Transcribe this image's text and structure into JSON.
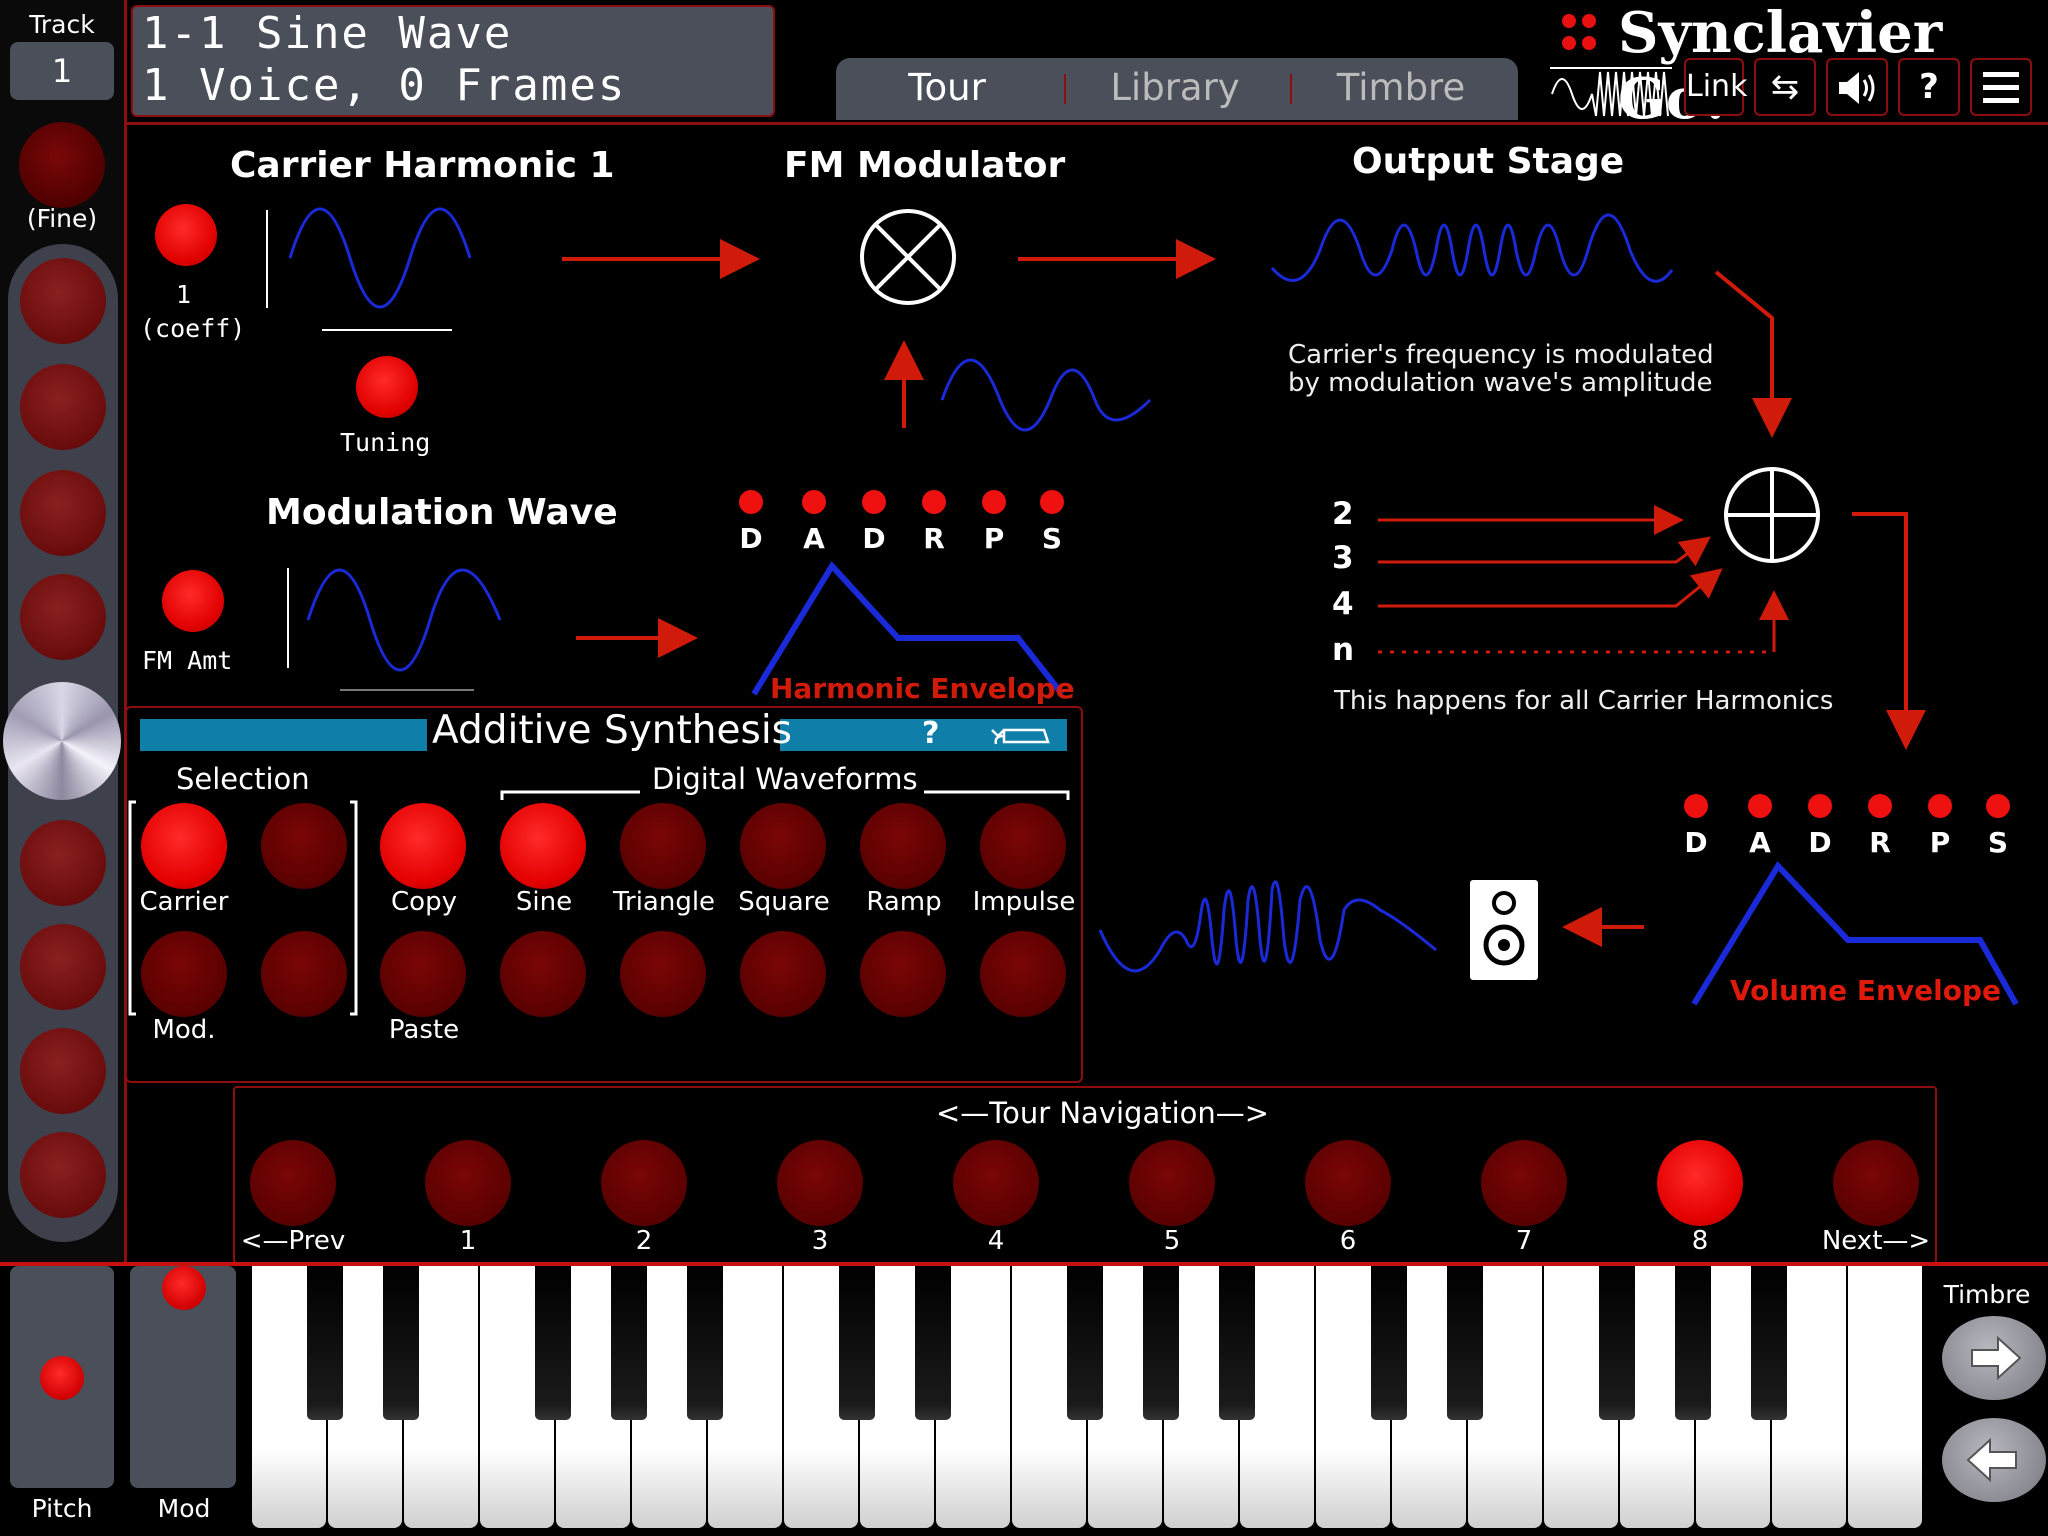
{
  "header": {
    "track_label": "Track",
    "track_value": "1",
    "fine_label": "(Fine)",
    "title_line1": "1-1 Sine Wave",
    "title_line2": "1 Voice, 0 Frames",
    "logo_text": "Synclavier Go!"
  },
  "tabs": [
    {
      "label": "Tour"
    },
    {
      "label": "Library"
    },
    {
      "label": "Timbre"
    }
  ],
  "toolbar": {
    "link_label": "Link",
    "swap_icon": "⇆",
    "volume_icon": "speaker-icon",
    "help_label": "?",
    "menu_icon": "hamburger-icon"
  },
  "diagram": {
    "carrier_title": "Carrier Harmonic 1",
    "carrier_coeff_value": "1",
    "carrier_coeff_label": "(coeff)",
    "tuning_label": "Tuning",
    "fm_title": "FM Modulator",
    "output_title": "Output Stage",
    "output_caption_1": "Carrier's frequency is modulated",
    "output_caption_2": "by modulation wave's amplitude",
    "mod_title": "Modulation Wave",
    "fm_amt_label": "FM Amt",
    "harmonic_env_label": "Harmonic Envelope",
    "volume_env_label": "Volume Envelope",
    "env_letters": [
      "D",
      "A",
      "D",
      "R",
      "P",
      "S"
    ],
    "sum_inputs": [
      "2",
      "3",
      "4",
      "n"
    ],
    "sum_caption": "This happens for all Carrier Harmonics"
  },
  "additive": {
    "title": "Additive Synthesis",
    "help": "?",
    "selection_label": "Selection",
    "waveforms_label": "Digital Waveforms",
    "carrier_label": "Carrier",
    "mod_label": "Mod.",
    "copy_label": "Copy",
    "paste_label": "Paste",
    "waveforms": [
      "Sine",
      "Triangle",
      "Square",
      "Ramp",
      "Impulse"
    ]
  },
  "tour_nav": {
    "title": "<—Tour Navigation—>",
    "items": [
      "<—Prev",
      "1",
      "2",
      "3",
      "4",
      "5",
      "6",
      "7",
      "8",
      "Next—>"
    ],
    "active_index": 8
  },
  "bottom": {
    "pitch_label": "Pitch",
    "mod_label": "Mod",
    "timbre_label": "Timbre"
  },
  "colors": {
    "accent_red": "#e00000",
    "panel_gray": "#4b4f5a",
    "wave_blue": "#1a2ad8",
    "bar_blue": "#0f7ea8",
    "border_red": "#8c0e0e"
  }
}
